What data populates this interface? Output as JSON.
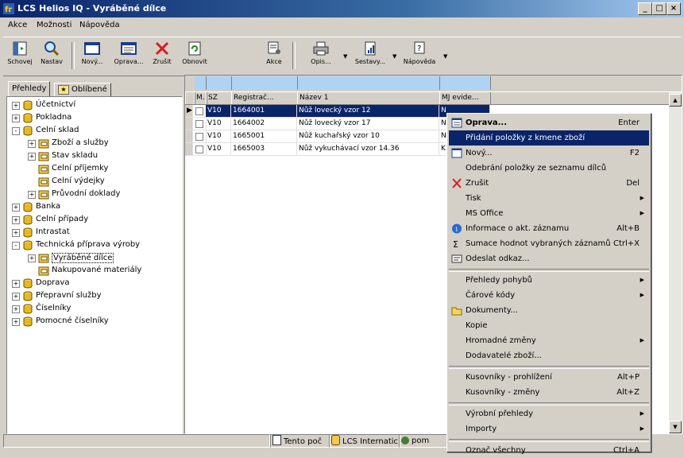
{
  "window": {
    "title": "LCS Helios IQ - Vyráběné dílce"
  },
  "menubar": [
    "Akce",
    "Možnosti",
    "Nápověda"
  ],
  "toolbar": {
    "buttons": [
      {
        "label": "Schovej",
        "icon": "hide-panel-icon"
      },
      {
        "label": "Nastav",
        "icon": "search-icon"
      },
      {
        "label": "Nový...",
        "icon": "new-window-icon"
      },
      {
        "label": "Oprava...",
        "icon": "edit-form-icon"
      },
      {
        "label": "Zrušit",
        "icon": "delete-x-icon"
      },
      {
        "label": "Obnovit",
        "icon": "refresh-icon"
      },
      {
        "label": "Akce",
        "icon": "actions-icon"
      },
      {
        "label": "Opis...",
        "icon": "printer-icon"
      },
      {
        "label": "Sestavy...",
        "icon": "reports-icon"
      },
      {
        "label": "Nápověda",
        "icon": "help-icon"
      }
    ]
  },
  "tabs": [
    "Přehledy",
    "Oblíbené"
  ],
  "tree": [
    {
      "label": "Účetnictví",
      "level": 0,
      "exp": "+"
    },
    {
      "label": "Pokladna",
      "level": 0,
      "exp": "+"
    },
    {
      "label": "Celní sklad",
      "level": 0,
      "exp": "-"
    },
    {
      "label": "Zboží a služby",
      "level": 1,
      "exp": "+"
    },
    {
      "label": "Stav skladu",
      "level": 1,
      "exp": "+"
    },
    {
      "label": "Celní příjemky",
      "level": 1,
      "exp": ""
    },
    {
      "label": "Celní výdejky",
      "level": 1,
      "exp": ""
    },
    {
      "label": "Průvodní doklady",
      "level": 1,
      "exp": "+"
    },
    {
      "label": "Banka",
      "level": 0,
      "exp": "+"
    },
    {
      "label": "Celní případy",
      "level": 0,
      "exp": "+"
    },
    {
      "label": "Intrastat",
      "level": 0,
      "exp": "+"
    },
    {
      "label": "Technická příprava výroby",
      "level": 0,
      "exp": "-"
    },
    {
      "label": "Vyráběné dílce",
      "level": 1,
      "exp": "+",
      "selected": true
    },
    {
      "label": "Nakupované materiály",
      "level": 1,
      "exp": ""
    },
    {
      "label": "Doprava",
      "level": 0,
      "exp": "+"
    },
    {
      "label": "Přepravní služby",
      "level": 0,
      "exp": "+"
    },
    {
      "label": "Číselníky",
      "level": 0,
      "exp": "+"
    },
    {
      "label": "Pomocné číselníky",
      "level": 0,
      "exp": "+"
    }
  ],
  "grid": {
    "headers": [
      "M.",
      "SZ",
      "Registrač...",
      "Název 1",
      "MJ evide..."
    ],
    "rows": [
      {
        "sz": "V10",
        "reg": "1664001",
        "name": "Nůž lovecký vzor 12",
        "mj": "N",
        "selected": true
      },
      {
        "sz": "V10",
        "reg": "1664002",
        "name": "Nůž lovecký vzor 17",
        "mj": "N"
      },
      {
        "sz": "V10",
        "reg": "1665001",
        "name": "Nůž kuchařský vzor 10",
        "mj": "N"
      },
      {
        "sz": "V10",
        "reg": "1665003",
        "name": "Nůž vykuchávací vzor 14.36",
        "mj": "K"
      }
    ]
  },
  "statusbar": [
    "Tento poč",
    "LCS Internatic",
    "pom"
  ],
  "context_menu": [
    {
      "label": "Oprava...",
      "shortcut": "Enter",
      "bold": true,
      "icon": "edit-form-icon"
    },
    {
      "label": "Přidání položky z kmene zboží",
      "highlight": true
    },
    {
      "label": "Nový...",
      "shortcut": "F2",
      "icon": "new-window-icon"
    },
    {
      "label": "Odebrání položky ze seznamu dílců"
    },
    {
      "label": "Zrušit",
      "shortcut": "Del",
      "icon": "delete-x-icon"
    },
    {
      "label": "Tisk",
      "submenu": true
    },
    {
      "label": "MS Office",
      "submenu": true
    },
    {
      "label": "Informace o akt. záznamu",
      "shortcut": "Alt+B",
      "icon": "info-icon"
    },
    {
      "label": "Sumace hodnot vybraných záznamů",
      "shortcut": "Ctrl+X",
      "icon": "sigma-icon"
    },
    {
      "label": "Odeslat odkaz...",
      "icon": "envelope-icon",
      "sep_after": true
    },
    {
      "label": "Přehledy pohybů",
      "submenu": true
    },
    {
      "label": "Čárové kódy",
      "submenu": true
    },
    {
      "label": "Dokumenty...",
      "icon": "folder-icon"
    },
    {
      "label": "Kopie"
    },
    {
      "label": "Hromadné změny",
      "submenu": true
    },
    {
      "label": "Dodavatelé zboží...",
      "sep_after": true
    },
    {
      "label": "Kusovníky - prohlížení",
      "shortcut": "Alt+P"
    },
    {
      "label": "Kusovníky - změny",
      "shortcut": "Alt+Z",
      "sep_after": true
    },
    {
      "label": "Výrobní přehledy",
      "submenu": true
    },
    {
      "label": "Importy",
      "submenu": true,
      "sep_after": true
    },
    {
      "label": "Označ všechny",
      "shortcut": "Ctrl+A"
    }
  ]
}
